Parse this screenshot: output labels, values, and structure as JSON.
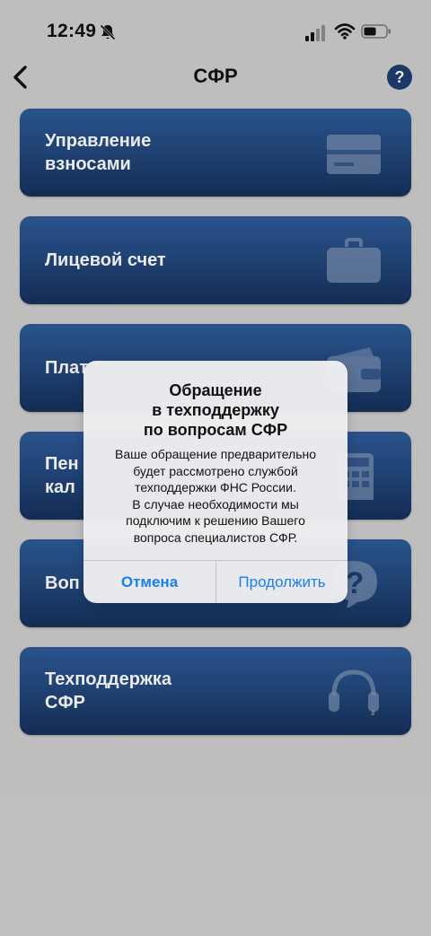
{
  "status_bar": {
    "time": "12:49"
  },
  "nav": {
    "title": "СФР",
    "help": "?"
  },
  "menu": {
    "items": [
      {
        "label": "Управление\n взносами",
        "icon": "card-icon"
      },
      {
        "label": "Лицевой счет",
        "icon": "briefcase-icon"
      },
      {
        "label": "Плат",
        "icon": "wallet-icon"
      },
      {
        "label": "Пен\n кал",
        "icon": "calculator-icon"
      },
      {
        "label": "Воп",
        "icon": "question-chat-icon"
      },
      {
        "label": "Техподдержка\n СФР",
        "icon": "headset-icon"
      }
    ]
  },
  "dialog": {
    "title": "Обращение\nв техподдержку\nпо вопросам СФР",
    "message": "Ваше обращение предварительно\nбудет рассмотрено службой\nтехподдержки ФНС России.\nВ случае необходимости мы\nподключим к решению Вашего\nвопроса специалистов СФР.",
    "cancel_label": "Отмена",
    "continue_label": "Продолжить"
  },
  "colors": {
    "accent": "#1a7ef0",
    "card": "#24497f",
    "background": "#cfcfcf"
  }
}
